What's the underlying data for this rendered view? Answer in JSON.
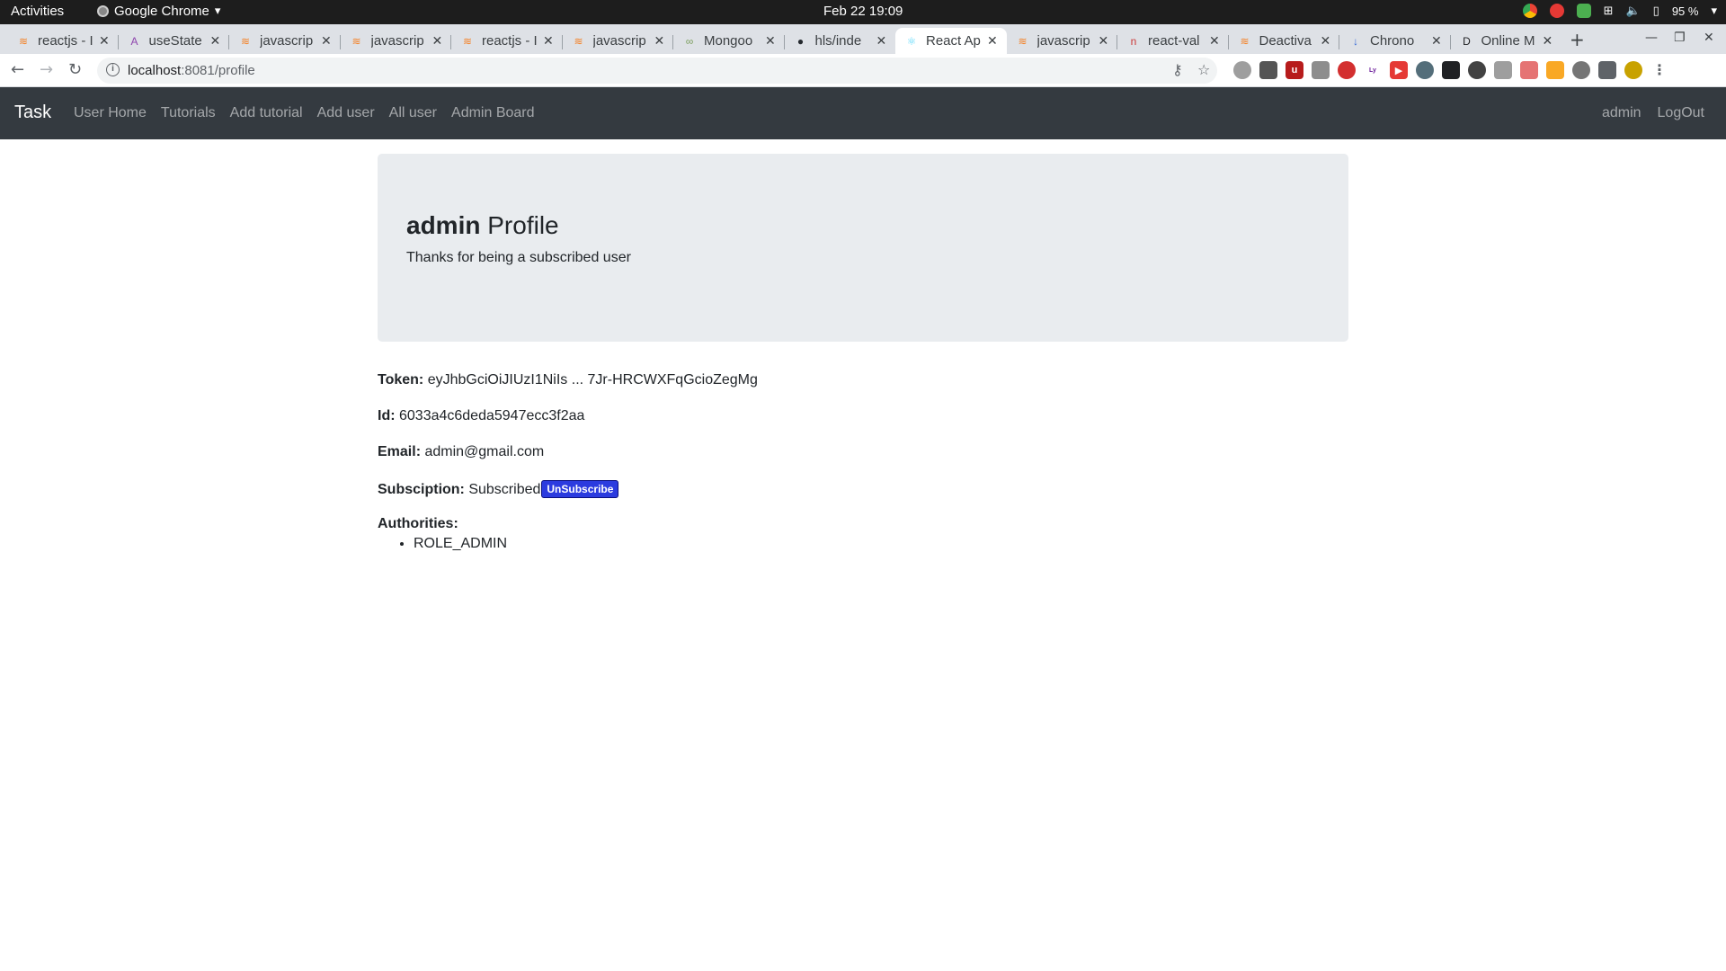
{
  "system_bar": {
    "activities": "Activities",
    "app_name": "Google Chrome",
    "clock": "Feb 22  19:09",
    "battery": "95 %"
  },
  "browser": {
    "tabs": [
      {
        "title": "reactjs - I",
        "icon": "stackoverflow-icon",
        "color": "#f48024"
      },
      {
        "title": "useState",
        "icon": "react-docs-icon",
        "color": "#8e44ad"
      },
      {
        "title": "javascrip",
        "icon": "stackoverflow-icon",
        "color": "#f48024"
      },
      {
        "title": "javascrip",
        "icon": "stackoverflow-icon",
        "color": "#f48024"
      },
      {
        "title": "reactjs - I",
        "icon": "stackoverflow-icon",
        "color": "#f48024"
      },
      {
        "title": "javascrip",
        "icon": "stackoverflow-icon",
        "color": "#f48024"
      },
      {
        "title": "Mongoo",
        "icon": "mongoose-icon",
        "color": "#7b9e5c"
      },
      {
        "title": "hls/inde",
        "icon": "github-icon",
        "color": "#24292e"
      },
      {
        "title": "React Ap",
        "icon": "react-icon",
        "color": "#61dafb"
      },
      {
        "title": "javascrip",
        "icon": "stackoverflow-icon",
        "color": "#f48024"
      },
      {
        "title": "react-val",
        "icon": "npm-icon",
        "color": "#cb3837"
      },
      {
        "title": "Deactiva",
        "icon": "stackoverflow-icon",
        "color": "#f48024"
      },
      {
        "title": "Chrono",
        "icon": "chrono-icon",
        "color": "#3367d6"
      },
      {
        "title": "Online M",
        "icon": "d-icon",
        "color": "#202124"
      }
    ],
    "active_tab_index": 8,
    "url_host": "localhost",
    "url_path": ":8081/profile"
  },
  "navbar": {
    "brand": "Task",
    "links": [
      "User Home",
      "Tutorials",
      "Add tutorial",
      "Add user",
      "All user",
      "Admin Board"
    ],
    "username": "admin",
    "logout": "LogOut"
  },
  "profile": {
    "username": "admin",
    "title_suffix": " Profile",
    "subtitle": "Thanks for being a subscribed user",
    "token_label": "Token:",
    "token_value": " eyJhbGciOiJIUzI1NiIs ... 7Jr-HRCWXFqGcioZegMg",
    "id_label": "Id:",
    "id_value": " 6033a4c6deda5947ecc3f2aa",
    "email_label": "Email:",
    "email_value": " admin@gmail.com",
    "subscription_label": "Subsciption:",
    "subscription_value": " Subscribed",
    "unsubscribe_button": "UnSubscribe",
    "authorities_label": "Authorities:",
    "authorities": [
      "ROLE_ADMIN"
    ]
  }
}
